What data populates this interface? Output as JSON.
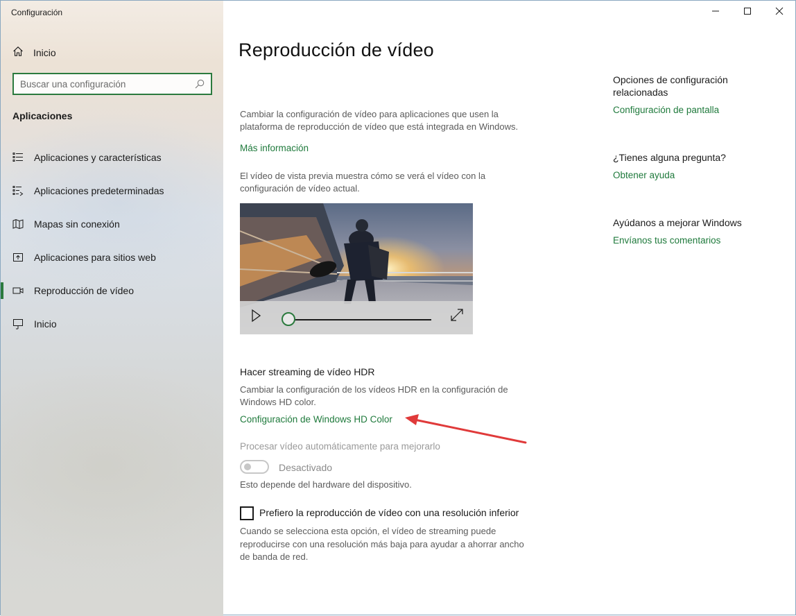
{
  "window": {
    "title": "Configuración",
    "controls": [
      "minimize-icon",
      "maximize-icon",
      "close-icon"
    ]
  },
  "sidebar": {
    "home_label": "Inicio",
    "search": {
      "placeholder": "Buscar una configuración",
      "value": ""
    },
    "section_label": "Aplicaciones",
    "items": [
      {
        "label": "Aplicaciones y características",
        "icon": "apps-features-icon"
      },
      {
        "label": "Aplicaciones predeterminadas",
        "icon": "default-apps-icon"
      },
      {
        "label": "Mapas sin conexión",
        "icon": "offline-maps-icon"
      },
      {
        "label": "Aplicaciones para sitios web",
        "icon": "apps-websites-icon"
      },
      {
        "label": "Reproducción de vídeo",
        "icon": "video-playback-icon",
        "active": true
      },
      {
        "label": "Inicio",
        "icon": "startup-icon"
      }
    ],
    "accent": "#2b7a3e"
  },
  "main": {
    "title": "Reproducción de vídeo",
    "intro_line1": "Cambiar la configuración de vídeo para aplicaciones que usen la",
    "intro_line2": "plataforma de reproducción de vídeo que está integrada en Windows.",
    "more_info": "Más información",
    "preview_line1": "El vídeo de vista previa muestra cómo se verá el vídeo con la",
    "preview_line2": "configuración de vídeo actual.",
    "video": {
      "progress": 0.0
    },
    "hdr": {
      "heading": "Hacer streaming de vídeo HDR",
      "desc_line1": "Cambiar la configuración de los vídeos HDR en la configuración de",
      "desc_line2": "Windows HD color.",
      "link": "Configuración de Windows HD Color"
    },
    "auto_process": {
      "title": "Procesar vídeo automáticamente para mejorarlo",
      "toggle_state": "Desactivado",
      "note": "Esto depende del hardware del dispositivo."
    },
    "low_res": {
      "label": "Prefiero la reproducción de vídeo con una resolución inferior",
      "checked": false,
      "desc_line1": "Cuando se selecciona esta opción, el vídeo de streaming puede",
      "desc_line2": "reproducirse con una resolución más baja para ayudar a ahorrar ancho",
      "desc_line3": "de banda de red."
    },
    "link_color": "#1f7a3c"
  },
  "related": {
    "heading_line1": "Opciones de configuración",
    "heading_line2": "relacionadas",
    "display_link": "Configuración de pantalla",
    "question": "¿Tienes alguna pregunta?",
    "help_link": "Obtener ayuda",
    "improve": "Ayúdanos a mejorar Windows",
    "feedback_link": "Envíanos tus comentarios"
  },
  "annotation": {
    "arrow_color": "#e03a3a"
  }
}
